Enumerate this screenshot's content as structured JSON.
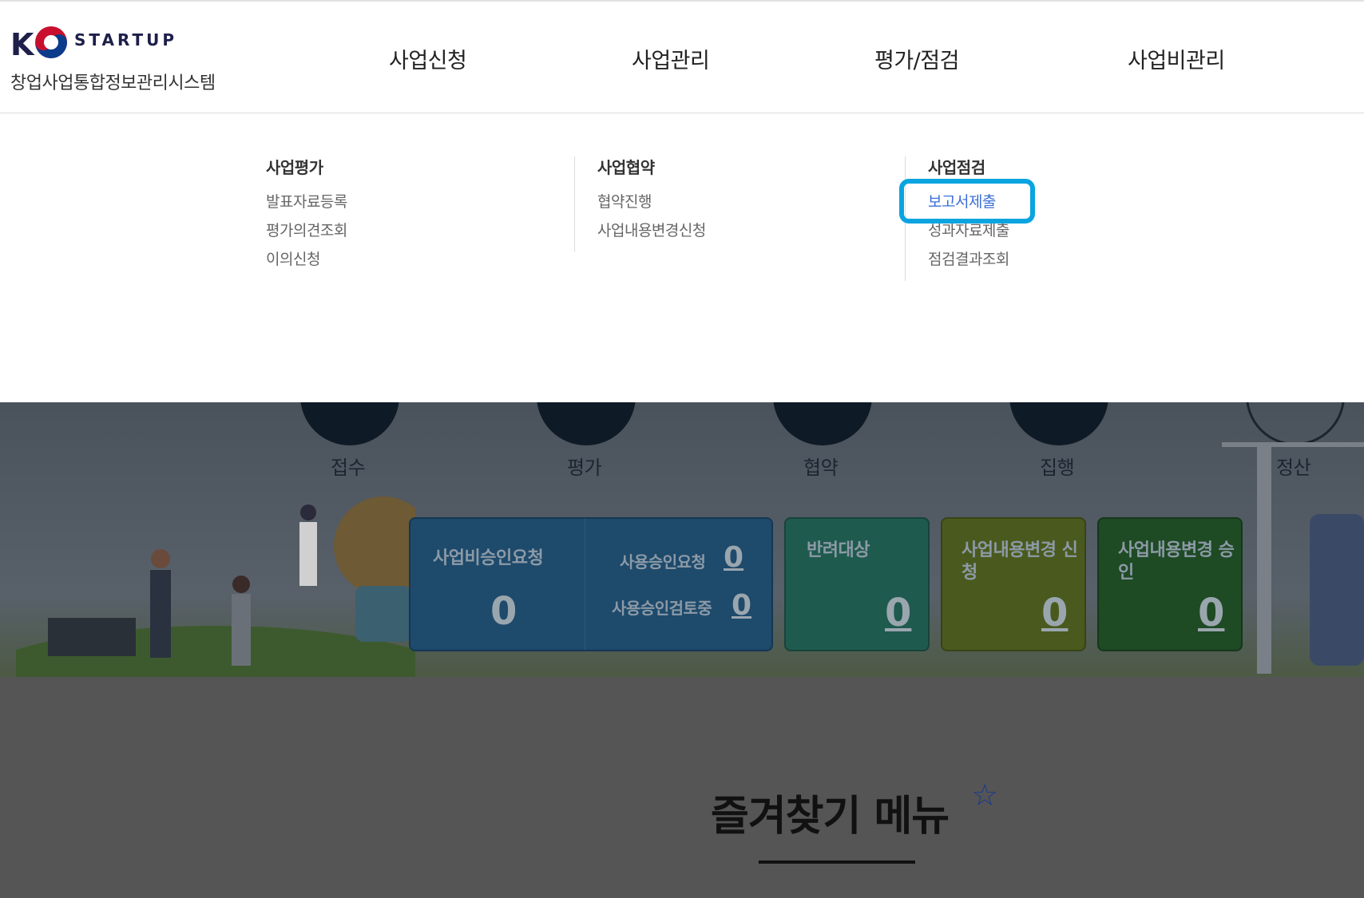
{
  "logo": {
    "k": "K",
    "startup": "STARTUP",
    "system": "창업사업통합정보관리시스템"
  },
  "gnb": [
    "사업신청",
    "사업관리",
    "평가/점검",
    "사업비관리"
  ],
  "mega_menu": {
    "columns": [
      {
        "title": "사업평가",
        "items": [
          "발표자료등록",
          "평가의견조회",
          "이의신청"
        ]
      },
      {
        "title": "사업협약",
        "items": [
          "협약진행",
          "사업내용변경신청"
        ]
      },
      {
        "title": "사업점검",
        "items": [
          "보고서제출",
          "성과자료제출",
          "점검결과조회"
        ]
      }
    ],
    "active_item": "보고서제출"
  },
  "stages": [
    "접수",
    "평가",
    "협약",
    "집행",
    "정산"
  ],
  "panels": {
    "approval": {
      "label": "사업비승인요청",
      "value": "0",
      "sub": [
        {
          "label": "사용승인요청",
          "value": "0"
        },
        {
          "label": "사용승인검토중",
          "value": "0"
        }
      ]
    },
    "rejected": {
      "label": "반려대상",
      "value": "0"
    },
    "change_request": {
      "label": "사업내용변경 신청",
      "value": "0"
    },
    "change_approved": {
      "label": "사업내용변경 승인",
      "value": "0"
    }
  },
  "favorites": {
    "title": "즐겨찾기 메뉴",
    "icon": "star-icon"
  },
  "colors": {
    "highlight": "#0aa4e0",
    "active_link": "#3a6fd8"
  }
}
